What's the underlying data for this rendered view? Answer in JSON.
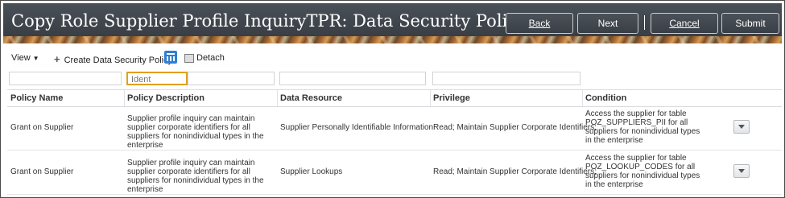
{
  "header": {
    "title": "Copy Role Supplier Profile InquiryTPR: Data Security Policies",
    "buttons": {
      "back": "Back",
      "next": "Next",
      "cancel": "Cancel",
      "submit": "Submit"
    }
  },
  "toolbar": {
    "view": "View",
    "create": "Create Data Security Policy",
    "detach": "Detach"
  },
  "filters": {
    "policy_name": "",
    "policy_description": "Ident",
    "data_resource": "",
    "privilege": ""
  },
  "table": {
    "columns": [
      "Policy Name",
      "Policy Description",
      "Data Resource",
      "Privilege",
      "Condition"
    ],
    "rows": [
      {
        "policy_name": "Grant on Supplier",
        "policy_description": "Supplier profile inquiry can maintain supplier corporate identifiers for all suppliers for nonindividual types in the enterprise",
        "data_resource": "Supplier Personally Identifiable Information",
        "privilege": "Read; Maintain Supplier Corporate Identifiers;",
        "condition": "Access the supplier for table POZ_SUPPLIERS_PII for all suppliers for nonindividual types in the enterprise"
      },
      {
        "policy_name": "Grant on Supplier",
        "policy_description": "Supplier profile inquiry can maintain supplier corporate identifiers for all suppliers for nonindividual types in the enterprise",
        "data_resource": "Supplier Lookups",
        "privilege": "Read; Maintain Supplier Corporate Identifiers;",
        "condition": "Access the supplier for table POZ_LOOKUP_CODES for all suppliers for nonindividual types in the enterprise"
      }
    ]
  },
  "icons": {
    "freeze": "freeze-columns-icon",
    "detach": "detach-icon",
    "plus": "plus-icon",
    "row_menu": "chevron-down-icon"
  },
  "colors": {
    "header_bg": "#3c4148",
    "active_filter_border": "#e0a020",
    "freeze_icon": "#2f7fd0"
  }
}
